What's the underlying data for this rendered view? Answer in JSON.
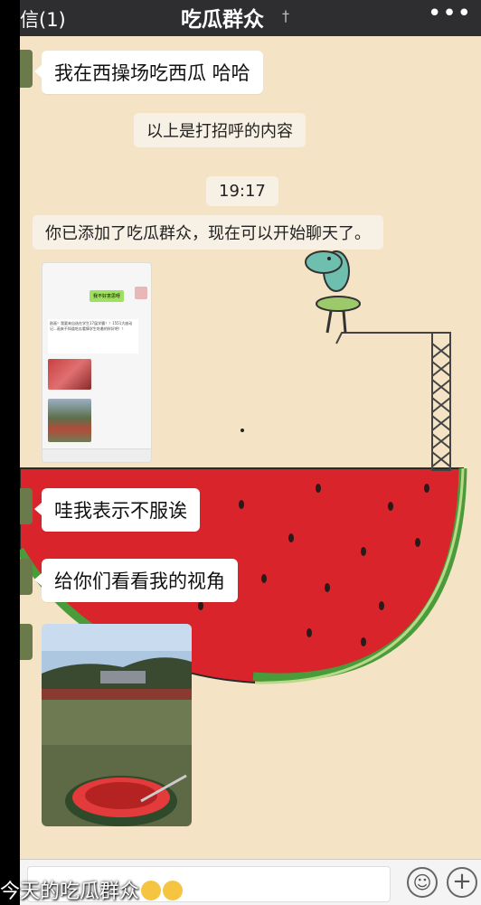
{
  "navbar": {
    "back_label": "信(1)",
    "title": "吃瓜群众",
    "ear_icon": "ear-icon",
    "more_icon": "•••"
  },
  "messages": {
    "msg1": "我在西操场吃西瓜  哈哈",
    "sys_greeting_note": "以上是打招呼的内容",
    "timestamp": "19:17",
    "sys_added": "你已添加了吃瓜群众，现在可以开始聊天了。",
    "msg2": "哇我表示不服诶",
    "msg3": "给你们看看我的视角"
  },
  "screenshot_thumb": {
    "bubble_text": "我不好意思呀",
    "text": "剧画！我要来自选在学生17届学霸！！1551大座动记...画来不知道吃瓜看情学生吃着的样好吧！！"
  },
  "caption": {
    "text": "今天的吃瓜群众"
  },
  "colors": {
    "background": "#f4e3c4",
    "navbar": "#2e2e31",
    "watermelon_red": "#d8242a",
    "rind_green": "#4a9b3a"
  }
}
